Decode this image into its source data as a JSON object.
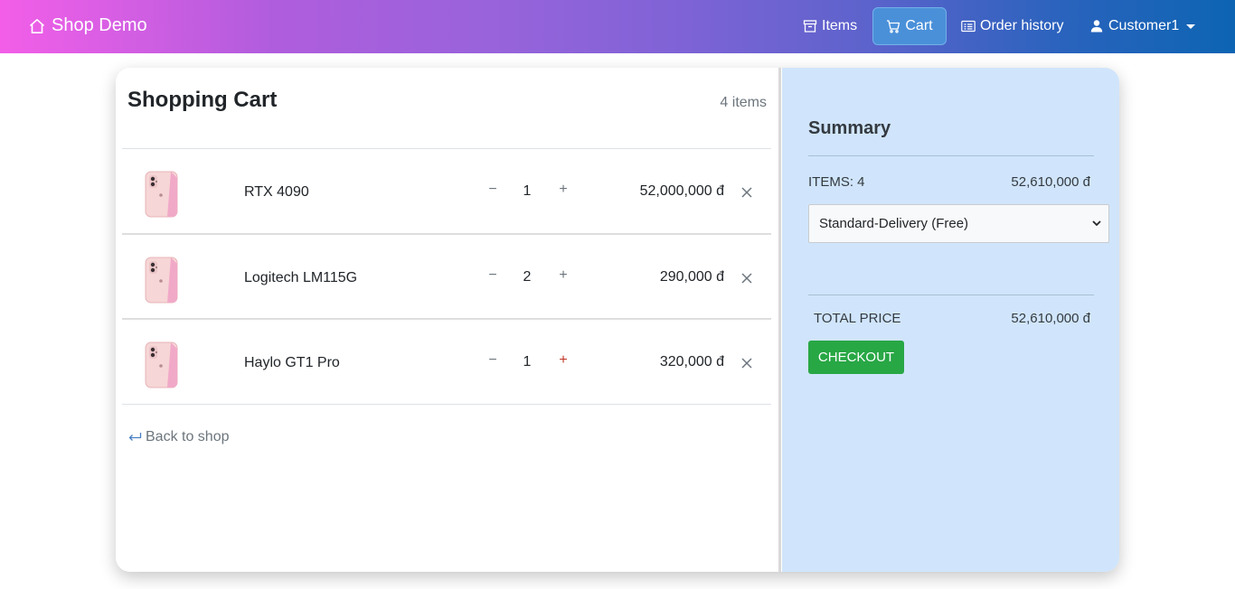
{
  "nav": {
    "brand": "Shop Demo",
    "items": "Items",
    "cart": "Cart",
    "order_history": "Order history",
    "user": "Customer1"
  },
  "cart": {
    "title": "Shopping Cart",
    "count_label": "4 items",
    "rows": [
      {
        "name": "RTX 4090",
        "minus": "−",
        "qty": "1",
        "plus": "+",
        "price": "52,000,000 đ"
      },
      {
        "name": "Logitech LM115G",
        "minus": "−",
        "qty": "2",
        "plus": "+",
        "price": "290,000 đ"
      },
      {
        "name": "Haylo GT1 Pro",
        "minus": "−",
        "qty": "1",
        "plus": "+",
        "price": "320,000 đ"
      }
    ],
    "back_label": "Back to shop"
  },
  "summary": {
    "title": "Summary",
    "items_label": "ITEMS: 4",
    "items_value": "52,610,000 đ",
    "delivery_selected": "Standard-Delivery (Free)",
    "total_label": "TOTAL PRICE",
    "total_value": "52,610,000 đ",
    "checkout_label": "CHECKOUT"
  },
  "colors": {
    "checkout": "#28a745",
    "summary_bg": "#d0e5fb",
    "nav_active": "#4a90d9"
  },
  "icons": {
    "brand": "house-icon",
    "items": "archive-box-icon",
    "cart": "cart-icon",
    "history": "receipt-card-icon",
    "user": "person-icon",
    "back": "return-arrow-icon",
    "remove": "close-icon",
    "product": "phone-thumbnail"
  }
}
